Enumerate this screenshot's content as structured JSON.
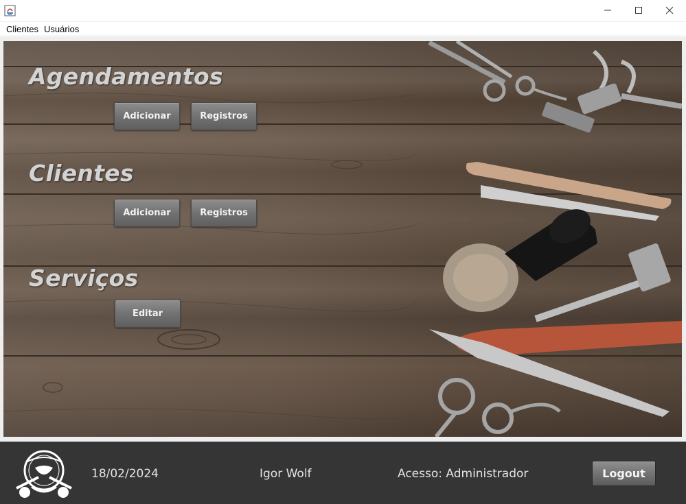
{
  "window": {
    "icon": "java-app-icon",
    "controls": [
      "minimize-icon",
      "maximize-icon",
      "close-icon"
    ]
  },
  "menu": {
    "clientes": "Clientes",
    "usuarios": "Usuários"
  },
  "sections": {
    "agendamentos": {
      "title": "Agendamentos",
      "add_label": "Adicionar",
      "records_label": "Registros"
    },
    "clientes": {
      "title": "Clientes",
      "add_label": "Adicionar",
      "records_label": "Registros"
    },
    "servicos": {
      "title": "Serviços",
      "edit_label": "Editar"
    }
  },
  "footer": {
    "logo": "barber-shop-logo",
    "date": "18/02/2024",
    "user": "Igor Wolf",
    "access": "Acesso: Administrador",
    "logout_label": "Logout"
  },
  "colors": {
    "footer_bg": "#353535",
    "button_gray": "#727272",
    "title_text": "#d3d3d3",
    "wood": "#5e4e41"
  }
}
